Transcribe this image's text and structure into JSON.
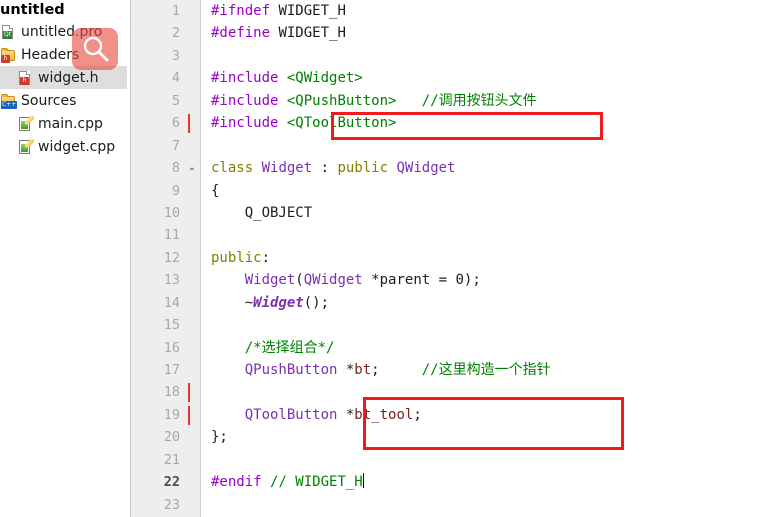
{
  "sidebar": {
    "project_name": "untitled",
    "items": [
      {
        "label": "untitled.pro",
        "icon": "qt-project-file-icon",
        "indent": 0,
        "selected": false,
        "type": "file-qt"
      },
      {
        "label": "Headers",
        "icon": "headers-folder-icon",
        "indent": 0,
        "selected": false,
        "type": "folder-h"
      },
      {
        "label": "widget.h",
        "icon": "header-file-icon",
        "indent": 1,
        "selected": true,
        "type": "file-h"
      },
      {
        "label": "Sources",
        "icon": "sources-folder-icon",
        "indent": 0,
        "selected": false,
        "type": "folder-cpp"
      },
      {
        "label": "main.cpp",
        "icon": "cpp-file-icon",
        "indent": 1,
        "selected": false,
        "type": "file-cpp"
      },
      {
        "label": "widget.cpp",
        "icon": "cpp-file-icon",
        "indent": 1,
        "selected": false,
        "type": "file-cpp"
      }
    ]
  },
  "overlay": {
    "cursor_icon": "magnifier-icon",
    "color": "#e94a40"
  },
  "editor": {
    "caret_line": 22,
    "current_line": 22,
    "change_marker_lines": [
      6,
      18,
      19
    ],
    "fold_marker_lines": [
      8
    ],
    "lines": [
      {
        "n": 1,
        "tokens": [
          {
            "t": "#ifndef",
            "c": "pre"
          },
          {
            "t": " ",
            "c": "plain"
          },
          {
            "t": "WIDGET_H",
            "c": "plain"
          }
        ]
      },
      {
        "n": 2,
        "tokens": [
          {
            "t": "#define",
            "c": "pre"
          },
          {
            "t": " ",
            "c": "plain"
          },
          {
            "t": "WIDGET_H",
            "c": "plain"
          }
        ]
      },
      {
        "n": 3,
        "tokens": []
      },
      {
        "n": 4,
        "tokens": [
          {
            "t": "#include",
            "c": "pre"
          },
          {
            "t": " ",
            "c": "plain"
          },
          {
            "t": "<QWidget>",
            "c": "str"
          }
        ]
      },
      {
        "n": 5,
        "tokens": [
          {
            "t": "#include",
            "c": "pre"
          },
          {
            "t": " ",
            "c": "plain"
          },
          {
            "t": "<QPushButton>",
            "c": "str"
          },
          {
            "t": "   ",
            "c": "plain"
          },
          {
            "t": "//调用按钮头文件",
            "c": "cmt"
          }
        ]
      },
      {
        "n": 6,
        "tokens": [
          {
            "t": "#include",
            "c": "pre"
          },
          {
            "t": " ",
            "c": "plain"
          },
          {
            "t": "<QToolButton>",
            "c": "str"
          }
        ]
      },
      {
        "n": 7,
        "tokens": []
      },
      {
        "n": 8,
        "tokens": [
          {
            "t": "class",
            "c": "kw"
          },
          {
            "t": " ",
            "c": "plain"
          },
          {
            "t": "Widget",
            "c": "type"
          },
          {
            "t": " : ",
            "c": "plain"
          },
          {
            "t": "public",
            "c": "kw"
          },
          {
            "t": " ",
            "c": "plain"
          },
          {
            "t": "QWidget",
            "c": "type"
          }
        ]
      },
      {
        "n": 9,
        "tokens": [
          {
            "t": "{",
            "c": "plain"
          }
        ]
      },
      {
        "n": 10,
        "tokens": [
          {
            "t": "    Q_OBJECT",
            "c": "plain"
          }
        ]
      },
      {
        "n": 11,
        "tokens": []
      },
      {
        "n": 12,
        "tokens": [
          {
            "t": "public",
            "c": "kw"
          },
          {
            "t": ":",
            "c": "plain"
          }
        ]
      },
      {
        "n": 13,
        "tokens": [
          {
            "t": "    ",
            "c": "plain"
          },
          {
            "t": "Widget",
            "c": "type"
          },
          {
            "t": "(",
            "c": "plain"
          },
          {
            "t": "QWidget",
            "c": "type"
          },
          {
            "t": " *parent = ",
            "c": "plain"
          },
          {
            "t": "0",
            "c": "num"
          },
          {
            "t": ");",
            "c": "plain"
          }
        ]
      },
      {
        "n": 14,
        "tokens": [
          {
            "t": "    ~",
            "c": "plain"
          },
          {
            "t": "Widget",
            "c": "type-b"
          },
          {
            "t": "();",
            "c": "plain"
          }
        ]
      },
      {
        "n": 15,
        "tokens": []
      },
      {
        "n": 16,
        "tokens": [
          {
            "t": "    ",
            "c": "plain"
          },
          {
            "t": "/*选择组合*/",
            "c": "cmt"
          }
        ]
      },
      {
        "n": 17,
        "tokens": [
          {
            "t": "    ",
            "c": "plain"
          },
          {
            "t": "QPushButton",
            "c": "type"
          },
          {
            "t": " *",
            "c": "plain"
          },
          {
            "t": "bt",
            "c": "var"
          },
          {
            "t": ";",
            "c": "plain"
          },
          {
            "t": "     ",
            "c": "plain"
          },
          {
            "t": "//这里构造一个指针",
            "c": "cmt"
          }
        ]
      },
      {
        "n": 18,
        "tokens": []
      },
      {
        "n": 19,
        "tokens": [
          {
            "t": "    ",
            "c": "plain"
          },
          {
            "t": "QToolButton",
            "c": "type"
          },
          {
            "t": " *",
            "c": "plain"
          },
          {
            "t": "bt_tool",
            "c": "var"
          },
          {
            "t": ";",
            "c": "plain"
          }
        ]
      },
      {
        "n": 20,
        "tokens": [
          {
            "t": "};",
            "c": "plain"
          }
        ]
      },
      {
        "n": 21,
        "tokens": []
      },
      {
        "n": 22,
        "tokens": [
          {
            "t": "#endif",
            "c": "pre"
          },
          {
            "t": " ",
            "c": "plain"
          },
          {
            "t": "// WIDGET_H",
            "c": "cmt"
          }
        ]
      },
      {
        "n": 23,
        "tokens": []
      }
    ]
  },
  "annotations": [
    {
      "name": "include-qtoolbutton-highlight",
      "color": "#f01c1c",
      "targets_line": 6
    },
    {
      "name": "qtoolbutton-decl-highlight",
      "color": "#f01c1c",
      "targets_line": 19
    }
  ]
}
